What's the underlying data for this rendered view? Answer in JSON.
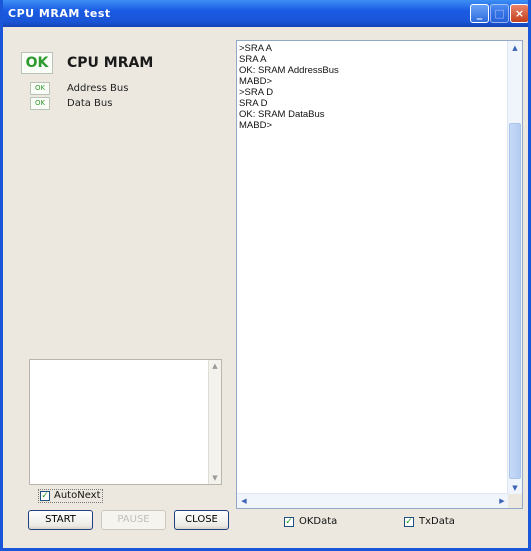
{
  "window": {
    "title": "CPU MRAM test",
    "minimize_symbol": "_",
    "maximize_symbol": "□",
    "close_symbol": "×"
  },
  "status": {
    "main_badge": "OK",
    "main_title": "CPU MRAM",
    "items": [
      {
        "badge": "OK",
        "label": "Address Bus"
      },
      {
        "badge": "OK",
        "label": "Data Bus"
      }
    ]
  },
  "log_box": {
    "text": ""
  },
  "autonext": {
    "label": "AutoNext",
    "checked": true
  },
  "buttons": {
    "start": "START",
    "pause": "PAUSE",
    "close": "CLOSE"
  },
  "console": {
    "lines": [
      ">SRA A",
      "SRA A",
      "OK: SRAM AddressBus",
      "MABD>",
      ">SRA D",
      "SRA D",
      "OK: SRAM DataBus",
      "MABD>"
    ]
  },
  "options": {
    "okdata": {
      "label": "OKData",
      "checked": true
    },
    "txdata": {
      "label": "TxData",
      "checked": true
    }
  },
  "colors": {
    "titlebar": "#1a57d8",
    "ok_text": "#2d9a2d",
    "window_bg": "#ece8df"
  }
}
